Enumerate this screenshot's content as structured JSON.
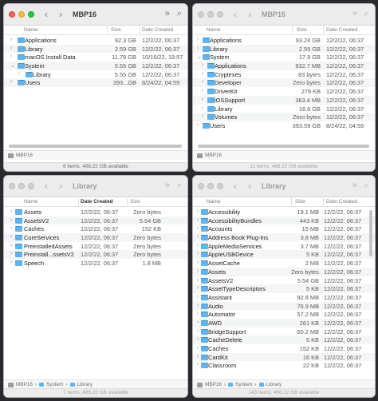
{
  "windows": {
    "w1": {
      "title": "MBP16",
      "cols": [
        "Name",
        "Size",
        "Date Created"
      ],
      "rows": [
        {
          "name": "Applications",
          "size": "92.3 GB",
          "date": "12/2/22, 06:37",
          "disc": "›",
          "indent": 0
        },
        {
          "name": "Library",
          "size": "2.59 GB",
          "date": "12/2/22, 06:37",
          "disc": "›",
          "indent": 0
        },
        {
          "name": "macOS Install Data",
          "size": "11.78 GB",
          "date": "10/16/22, 18:57",
          "disc": "›",
          "indent": 0
        },
        {
          "name": "System",
          "size": "5.55 GB",
          "date": "12/2/22, 06:37",
          "disc": "⌄",
          "indent": 0
        },
        {
          "name": "Library",
          "size": "5.55 GB",
          "date": "12/2/22, 06:37",
          "disc": "›",
          "indent": 1
        },
        {
          "name": "Users",
          "size": "393...GB",
          "date": "8/24/22, 04:59",
          "disc": "›",
          "indent": 0
        }
      ],
      "path": [
        "MBP16"
      ],
      "status": "6 items, 486.22 GB available"
    },
    "w2": {
      "title": "MBP16",
      "cols": [
        "Name",
        "Size",
        "Date Created"
      ],
      "rows": [
        {
          "name": "Applications",
          "size": "93.24 GB",
          "date": "12/2/22, 06:37",
          "disc": "›",
          "indent": 0
        },
        {
          "name": "Library",
          "size": "2.59 GB",
          "date": "12/2/22, 06:37",
          "disc": "›",
          "indent": 0
        },
        {
          "name": "System",
          "size": "17.9 GB",
          "date": "12/2/22, 06:37",
          "disc": "⌄",
          "indent": 0
        },
        {
          "name": "Applications",
          "size": "932.7 MB",
          "date": "12/2/22, 06:37",
          "disc": "›",
          "indent": 1
        },
        {
          "name": "Cryptexes",
          "size": "83 bytes",
          "date": "12/2/22, 06:37",
          "disc": "›",
          "indent": 1
        },
        {
          "name": "Developer",
          "size": "Zero bytes",
          "date": "12/2/22, 06:37",
          "disc": "›",
          "indent": 1
        },
        {
          "name": "DriverKit",
          "size": "279 KB",
          "date": "12/2/22, 06:37",
          "disc": "›",
          "indent": 1
        },
        {
          "name": "iOSSupport",
          "size": "363.4 MB",
          "date": "12/2/22, 06:37",
          "disc": "›",
          "indent": 1
        },
        {
          "name": "Library",
          "size": "16.6 GB",
          "date": "12/2/22, 06:37",
          "disc": "›",
          "indent": 1
        },
        {
          "name": "Volumes",
          "size": "Zero bytes",
          "date": "12/2/22, 06:37",
          "disc": "›",
          "indent": 1
        },
        {
          "name": "Users",
          "size": "393.59 GB",
          "date": "8/24/22, 04:59",
          "disc": "›",
          "indent": 0
        }
      ],
      "path": [
        "MBP16"
      ],
      "status": "11 items, 486.22 GB available"
    },
    "w3": {
      "title": "Library",
      "cols": [
        "Name",
        "Date Created",
        "Size"
      ],
      "rows": [
        {
          "name": "Assets",
          "date": "12/2/22, 06:37",
          "size": "Zero bytes",
          "disc": "›"
        },
        {
          "name": "AssetsV2",
          "date": "12/2/22, 06:37",
          "size": "5.54 GB",
          "disc": "›"
        },
        {
          "name": "Caches",
          "date": "12/2/22, 06:37",
          "size": "152 KB",
          "disc": "›"
        },
        {
          "name": "CoreServices",
          "date": "12/2/22, 06:37",
          "size": "Zero bytes",
          "disc": "›"
        },
        {
          "name": "PreinstalledAssets",
          "date": "12/2/22, 06:37",
          "size": "Zero bytes",
          "disc": "›"
        },
        {
          "name": "Preinstall...ssetsV2",
          "date": "12/2/22, 06:37",
          "size": "Zero bytes",
          "disc": "›"
        },
        {
          "name": "Speech",
          "date": "12/2/22, 06:37",
          "size": "1.8 MB",
          "disc": "›"
        }
      ],
      "path": [
        "MBP16",
        "System",
        "Library"
      ],
      "status": "7 items, 486.22 GB available"
    },
    "w4": {
      "title": "Library",
      "cols": [
        "Name",
        "Size",
        "Date Created"
      ],
      "rows": [
        {
          "name": "Accessibility",
          "size": "19.1 MB",
          "date": "12/2/22, 06:37",
          "disc": "›"
        },
        {
          "name": "AccessibilityBundles",
          "size": "443 KB",
          "date": "12/2/22, 06:37",
          "disc": "›"
        },
        {
          "name": "Accounts",
          "size": "15 MB",
          "date": "12/2/22, 06:37",
          "disc": "›"
        },
        {
          "name": "Address Book Plug-Ins",
          "size": "3.8 MB",
          "date": "12/2/22, 06:37",
          "disc": "›"
        },
        {
          "name": "AppleMediaServices",
          "size": "3.7 MB",
          "date": "12/2/22, 06:37",
          "disc": "›"
        },
        {
          "name": "AppleUSBDevice",
          "size": "5 KB",
          "date": "12/2/22, 06:37",
          "disc": "›"
        },
        {
          "name": "AssetCache",
          "size": "2 MB",
          "date": "12/2/22, 06:37",
          "disc": "›"
        },
        {
          "name": "Assets",
          "size": "Zero bytes",
          "date": "12/2/22, 06:37",
          "disc": "›"
        },
        {
          "name": "AssetsV2",
          "size": "5.54 GB",
          "date": "12/2/22, 06:37",
          "disc": "›"
        },
        {
          "name": "AssetTypeDescriptors",
          "size": "5 KB",
          "date": "12/2/22, 06:37",
          "disc": "›"
        },
        {
          "name": "Assistant",
          "size": "92.8 MB",
          "date": "12/2/22, 06:37",
          "disc": "›"
        },
        {
          "name": "Audio",
          "size": "76.9 MB",
          "date": "12/2/22, 06:37",
          "disc": "›"
        },
        {
          "name": "Automator",
          "size": "57.2 MB",
          "date": "12/2/22, 06:37",
          "disc": "›"
        },
        {
          "name": "AWD",
          "size": "261 KB",
          "date": "12/2/22, 06:37",
          "disc": "›"
        },
        {
          "name": "BridgeSupport",
          "size": "60.2 MB",
          "date": "12/2/22, 06:37",
          "disc": "›"
        },
        {
          "name": "CacheDelete",
          "size": "5 KB",
          "date": "12/2/22, 06:37",
          "disc": "›"
        },
        {
          "name": "Caches",
          "size": "152 KB",
          "date": "12/2/22, 06:37",
          "disc": "›"
        },
        {
          "name": "CardKit",
          "size": "16 KB",
          "date": "12/2/22, 06:37",
          "disc": "›"
        },
        {
          "name": "Classroom",
          "size": "22 KB",
          "date": "12/2/22, 06:37",
          "disc": "›"
        }
      ],
      "path": [
        "MBP16",
        "System",
        "Library"
      ],
      "status": "143 items, 486.22 GB available"
    }
  },
  "icons": {
    "back": "‹",
    "forward": "›",
    "more": "»",
    "search": "⌕",
    "path_sep": "›"
  },
  "colors": {
    "folder": "#5eb4f0",
    "close": "#fe5f57",
    "minimize": "#febc2e",
    "zoom": "#28c840"
  }
}
